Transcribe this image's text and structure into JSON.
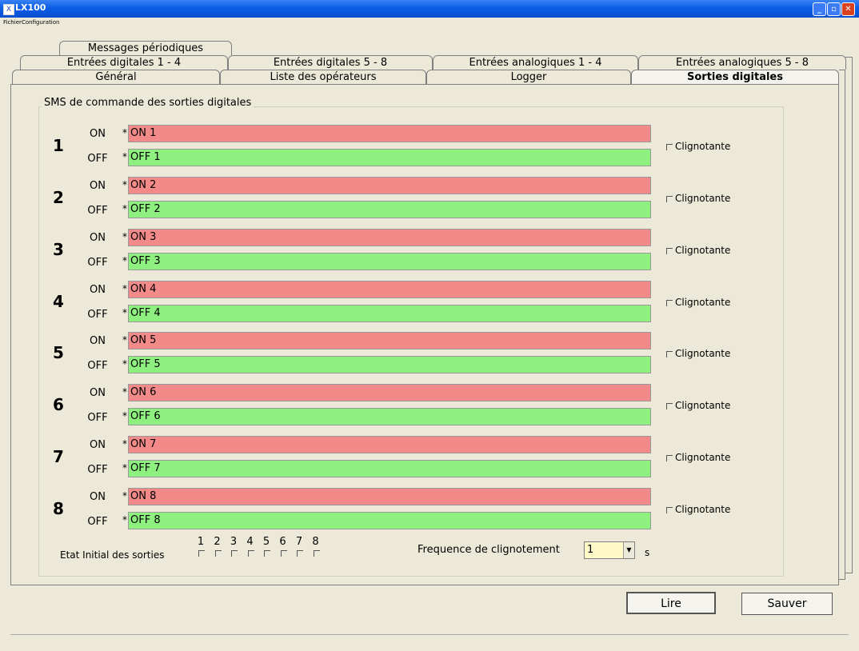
{
  "window": {
    "title": "LX100"
  },
  "menu": {
    "fichier": "Fichier",
    "configuration": "Configuration"
  },
  "tabs": {
    "row1": [
      {
        "label": "Messages périodiques"
      }
    ],
    "row2": [
      {
        "label": "Entrées digitales 1 - 4"
      },
      {
        "label": "Entrées digitales 5 - 8"
      },
      {
        "label": "Entrées analogiques 1 - 4"
      },
      {
        "label": "Entrées analogiques 5 - 8"
      }
    ],
    "row3": [
      {
        "label": "Général"
      },
      {
        "label": "Liste des opérateurs"
      },
      {
        "label": "Logger"
      },
      {
        "label": "Sorties digitales"
      }
    ]
  },
  "group": {
    "title": "SMS de commande des sorties digitales"
  },
  "labels": {
    "on": "ON",
    "off": "OFF",
    "star": "*",
    "blink": "Clignotante"
  },
  "outputs": [
    {
      "num": "1",
      "on": "ON 1",
      "off": "OFF 1"
    },
    {
      "num": "2",
      "on": "ON 2",
      "off": "OFF 2"
    },
    {
      "num": "3",
      "on": "ON 3",
      "off": "OFF 3"
    },
    {
      "num": "4",
      "on": "ON 4",
      "off": "OFF 4"
    },
    {
      "num": "5",
      "on": "ON 5",
      "off": "OFF 5"
    },
    {
      "num": "6",
      "on": "ON 6",
      "off": "OFF 6"
    },
    {
      "num": "7",
      "on": "ON 7",
      "off": "OFF 7"
    },
    {
      "num": "8",
      "on": "ON 8",
      "off": "OFF 8"
    }
  ],
  "initial": {
    "label": "Etat Initial des sorties",
    "numbers": [
      "1",
      "2",
      "3",
      "4",
      "5",
      "6",
      "7",
      "8"
    ]
  },
  "frequency": {
    "label": "Frequence de clignotement",
    "value": "1",
    "unit": "s"
  },
  "buttons": {
    "read": "Lire",
    "save": "Sauver"
  },
  "colors": {
    "on_field": "#f28a8a",
    "off_field": "#8ef07f",
    "freq_field": "#fff9c8"
  }
}
